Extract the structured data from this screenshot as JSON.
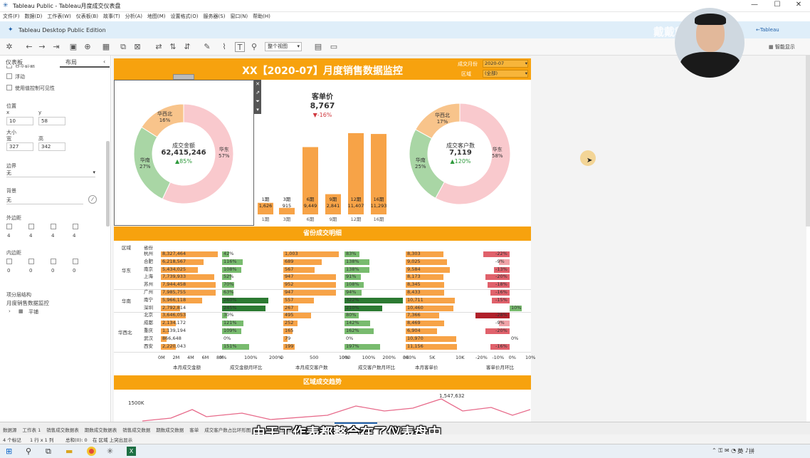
{
  "window": {
    "title": "Tableau Public - Tableau月度成交仪表盘"
  },
  "menu": [
    "文件(F)",
    "数据(D)",
    "工作表(W)",
    "仪表板(B)",
    "故事(T)",
    "分析(A)",
    "地图(M)",
    "设置格式(O)",
    "服务器(S)",
    "窗口(N)",
    "帮助(H)"
  ],
  "edition": {
    "label": "Tableau Desktop Public Edition",
    "right_label": "←Tableau",
    "smart_show": "智能显示",
    "watermark": "戴戴戴师兄"
  },
  "toolbar": {
    "fit": "整个视图"
  },
  "left_pane": {
    "tabs": [
      "仪表板",
      "布局"
    ],
    "float_label": "浮动",
    "show_title": "显示标题",
    "show_hide": "使用值控制可见性",
    "position_label": "位置",
    "x_label": "x",
    "y_label": "y",
    "x": "10",
    "y": "58",
    "size_label": "大小",
    "w_label": "宽",
    "h_label": "高",
    "w": "327",
    "h": "342",
    "border_label": "边界",
    "border_value": "无",
    "bg_label": "背景",
    "bg_value": "无",
    "outer_pad_label": "外边距",
    "outer_pad": [
      "4",
      "4",
      "4",
      "4"
    ],
    "inner_pad_label": "内边距",
    "inner_pad": [
      "0",
      "0",
      "0",
      "0"
    ],
    "tree_label": "项分层结构",
    "tree_item": "月度销售数据监控",
    "tree_child": "平铺"
  },
  "dashboard": {
    "title": "XX【2020-07】月度销售数据监控",
    "filters": [
      {
        "label": "成交月份",
        "value": "2020-07"
      },
      {
        "label": "区域",
        "value": "(全部)"
      }
    ],
    "donut1": {
      "center_label": "成交金额",
      "center_value": "62,415,246",
      "center_delta": "▲85%",
      "slices": [
        {
          "name": "华东",
          "pct": "57%",
          "value": 0.57,
          "color": "#f9c9cd"
        },
        {
          "name": "华南",
          "pct": "27%",
          "value": 0.27,
          "color": "#a9d6a5"
        },
        {
          "name": "华西北",
          "pct": "16%",
          "value": 0.16,
          "color": "#f8c48b"
        }
      ]
    },
    "donut2": {
      "center_label": "成交客户数",
      "center_value": "7,119",
      "center_delta": "▲120%",
      "slices": [
        {
          "name": "华东",
          "pct": "58%",
          "value": 0.58,
          "color": "#f9c9cd"
        },
        {
          "name": "华南",
          "pct": "25%",
          "value": 0.25,
          "color": "#a9d6a5"
        },
        {
          "name": "华西北",
          "pct": "17%",
          "value": 0.17,
          "color": "#f8c48b"
        }
      ]
    },
    "kpi": {
      "title": "客单价",
      "value": "8,767",
      "delta": "▼-16%"
    },
    "province_section": "省份成交明细",
    "trend_section": "区域成交趋势",
    "trend_label": "1,547,632",
    "trend_axis": "1500K",
    "table_headers": [
      "区域",
      "省份"
    ],
    "regions": [
      "华东",
      "华南",
      "华西北"
    ],
    "axis_labels": [
      "本月成交金额",
      "成交金额月环比",
      "本月成交客户数",
      "成交客户数月环比",
      "本月客单价",
      "客单价月环比"
    ],
    "axis_ticks": [
      [
        "0M",
        "2M",
        "4M",
        "6M",
        "8M"
      ],
      [
        "0%",
        "100%",
        "200%"
      ],
      [
        "0",
        "500",
        "1000"
      ],
      [
        "0%",
        "100%",
        "200%",
        "300%"
      ],
      [
        "0K",
        "5K",
        "10K"
      ],
      [
        "-20%",
        "-10%",
        "0%",
        "10%"
      ]
    ]
  },
  "chart_data": {
    "type": "bar",
    "title": "客单价",
    "categories": [
      "1期",
      "3期",
      "6期",
      "9期",
      "12期",
      "16期"
    ],
    "values": [
      1626,
      915,
      9449,
      2841,
      11407,
      11293
    ],
    "value_labels": [
      "1,626",
      "915",
      "9,449",
      "2,841",
      "11,407",
      "11,293"
    ]
  },
  "table": [
    {
      "prov": "杭州",
      "amt": "8,327,464",
      "amt_v": 8327464,
      "amom": "42%",
      "amom_v": 42,
      "cust": "1,003",
      "cust_v": 1003,
      "cmom": "83%",
      "cmom_v": 83,
      "price": "8,303",
      "price_v": 8303,
      "pmom": "-22%",
      "pmom_v": -22
    },
    {
      "prov": "合肥",
      "amt": "6,218,567",
      "amt_v": 6218567,
      "amom": "116%",
      "amom_v": 116,
      "cust": "689",
      "cust_v": 689,
      "cmom": "138%",
      "cmom_v": 138,
      "price": "9,025",
      "price_v": 9025,
      "pmom": "-9%",
      "pmom_v": -9
    },
    {
      "prov": "南京",
      "amt": "5,434,025",
      "amt_v": 5434025,
      "amom": "108%",
      "amom_v": 108,
      "cust": "567",
      "cust_v": 567,
      "cmom": "138%",
      "cmom_v": 138,
      "price": "9,584",
      "price_v": 9584,
      "pmom": "-13%",
      "pmom_v": -13
    },
    {
      "prov": "上海",
      "amt": "7,739,933",
      "amt_v": 7739933,
      "amom": "52%",
      "amom_v": 52,
      "cust": "947",
      "cust_v": 947,
      "cmom": "91%",
      "cmom_v": 91,
      "price": "8,173",
      "price_v": 8173,
      "pmom": "-20%",
      "pmom_v": -20
    },
    {
      "prov": "苏州",
      "amt": "7,944,458",
      "amt_v": 7944458,
      "amom": "70%",
      "amom_v": 70,
      "cust": "952",
      "cust_v": 952,
      "cmom": "108%",
      "cmom_v": 108,
      "price": "8,345",
      "price_v": 8345,
      "pmom": "-18%",
      "pmom_v": -18
    },
    {
      "prov": "广州",
      "amt": "7,985,755",
      "amt_v": 7985755,
      "amom": "63%",
      "amom_v": 63,
      "cust": "947",
      "cust_v": 947,
      "cmom": "94%",
      "cmom_v": 94,
      "price": "8,433",
      "price_v": 8433,
      "pmom": "-16%",
      "pmom_v": -16
    },
    {
      "prov": "南宁",
      "amt": "5,966,118",
      "amt_v": 5966118,
      "amom": "260%",
      "amom_v": 260,
      "cust": "557",
      "cust_v": 557,
      "cmom": "322%",
      "cmom_v": 322,
      "price": "10,711",
      "price_v": 10711,
      "pmom": "-15%",
      "pmom_v": -15
    },
    {
      "prov": "深圳",
      "amt": "2,792,814",
      "amt_v": 2792814,
      "amom": "245%",
      "amom_v": 245,
      "cust": "267",
      "cust_v": 267,
      "cmom": "210%",
      "cmom_v": 210,
      "price": "10,460",
      "price_v": 10460,
      "pmom": "10%",
      "pmom_v": 10
    },
    {
      "prov": "北京",
      "amt": "3,646,053",
      "amt_v": 3646053,
      "amom": "30%",
      "amom_v": 30,
      "cust": "495",
      "cust_v": 495,
      "cmom": "80%",
      "cmom_v": 80,
      "price": "7,366",
      "price_v": 7366,
      "pmom": "-28%",
      "pmom_v": -28
    },
    {
      "prov": "成都",
      "amt": "2,134,172",
      "amt_v": 2134172,
      "amom": "121%",
      "amom_v": 121,
      "cust": "252",
      "cust_v": 252,
      "cmom": "142%",
      "cmom_v": 142,
      "price": "8,469",
      "price_v": 8469,
      "pmom": "-9%",
      "pmom_v": -9
    },
    {
      "prov": "重庆",
      "amt": "1,139,194",
      "amt_v": 1139194,
      "amom": "109%",
      "amom_v": 109,
      "cust": "165",
      "cust_v": 165,
      "cmom": "162%",
      "cmom_v": 162,
      "price": "6,904",
      "price_v": 6904,
      "pmom": "-20%",
      "pmom_v": -20
    },
    {
      "prov": "武汉",
      "amt": "866,648",
      "amt_v": 866648,
      "amom": "0%",
      "amom_v": 0,
      "cust": "79",
      "cust_v": 79,
      "cmom": "0%",
      "cmom_v": 0,
      "price": "10,970",
      "price_v": 10970,
      "pmom": "0%",
      "pmom_v": 0
    },
    {
      "prov": "西安",
      "amt": "2,220,043",
      "amt_v": 2220043,
      "amom": "151%",
      "amom_v": 151,
      "cust": "199",
      "cust_v": 199,
      "cmom": "197%",
      "cmom_v": 197,
      "price": "11,156",
      "price_v": 11156,
      "pmom": "-16%",
      "pmom_v": -16
    }
  ],
  "sheet_tabs": [
    "数据源",
    "工作表 1",
    "销售成交数据表",
    "期数成交数据表",
    "销售成交数据",
    "期数成交数据",
    "客单",
    "成交客户数占比环形图",
    "成交金额占比环形图",
    "客单价指标卡",
    "月度销售数据监控"
  ],
  "status": {
    "marks": "4 个标记",
    "rows": "1 行 x 1 列",
    "sum": "总和(0): 0",
    "zone": "在 区域 上突出显示"
  },
  "subtitle": "由于工作表都整合在了仪表盘中",
  "tray": {
    "lang": "英",
    "ime": "拼"
  }
}
